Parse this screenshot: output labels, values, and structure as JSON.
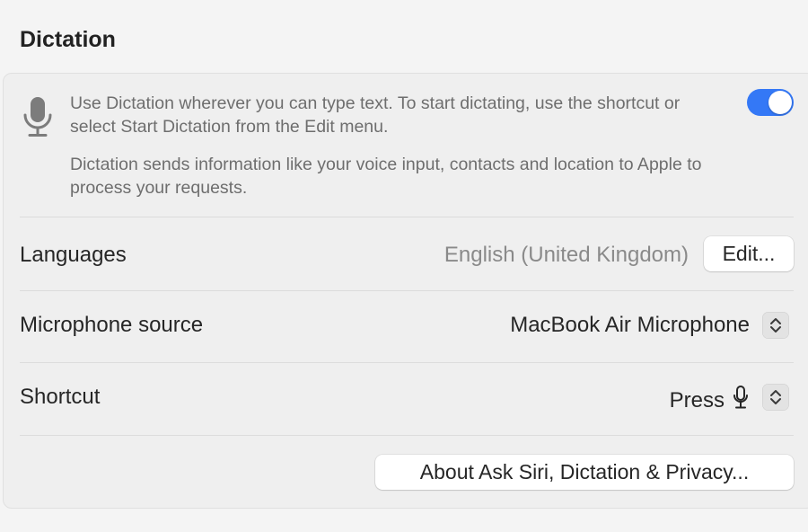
{
  "section": {
    "title": "Dictation"
  },
  "intro": {
    "description": "Use Dictation wherever you can type text. To start dictating, use the shortcut or select Start Dictation from the Edit menu.",
    "privacy_note": "Dictation sends information like your voice input, contacts and location to Apple to process your requests.",
    "toggle_on": true,
    "icon": "microphone-icon"
  },
  "languages": {
    "label": "Languages",
    "value": "English (United Kingdom)",
    "edit_button": "Edit..."
  },
  "microphone_source": {
    "label": "Microphone source",
    "value": "MacBook Air Microphone"
  },
  "shortcut": {
    "label": "Shortcut",
    "value": "Press",
    "key_icon": "microphone-key-icon"
  },
  "about_button": "About Ask Siri, Dictation & Privacy...",
  "colors": {
    "accent": "#3478f6",
    "panel": "#efefef",
    "background": "#f4f4f4"
  }
}
